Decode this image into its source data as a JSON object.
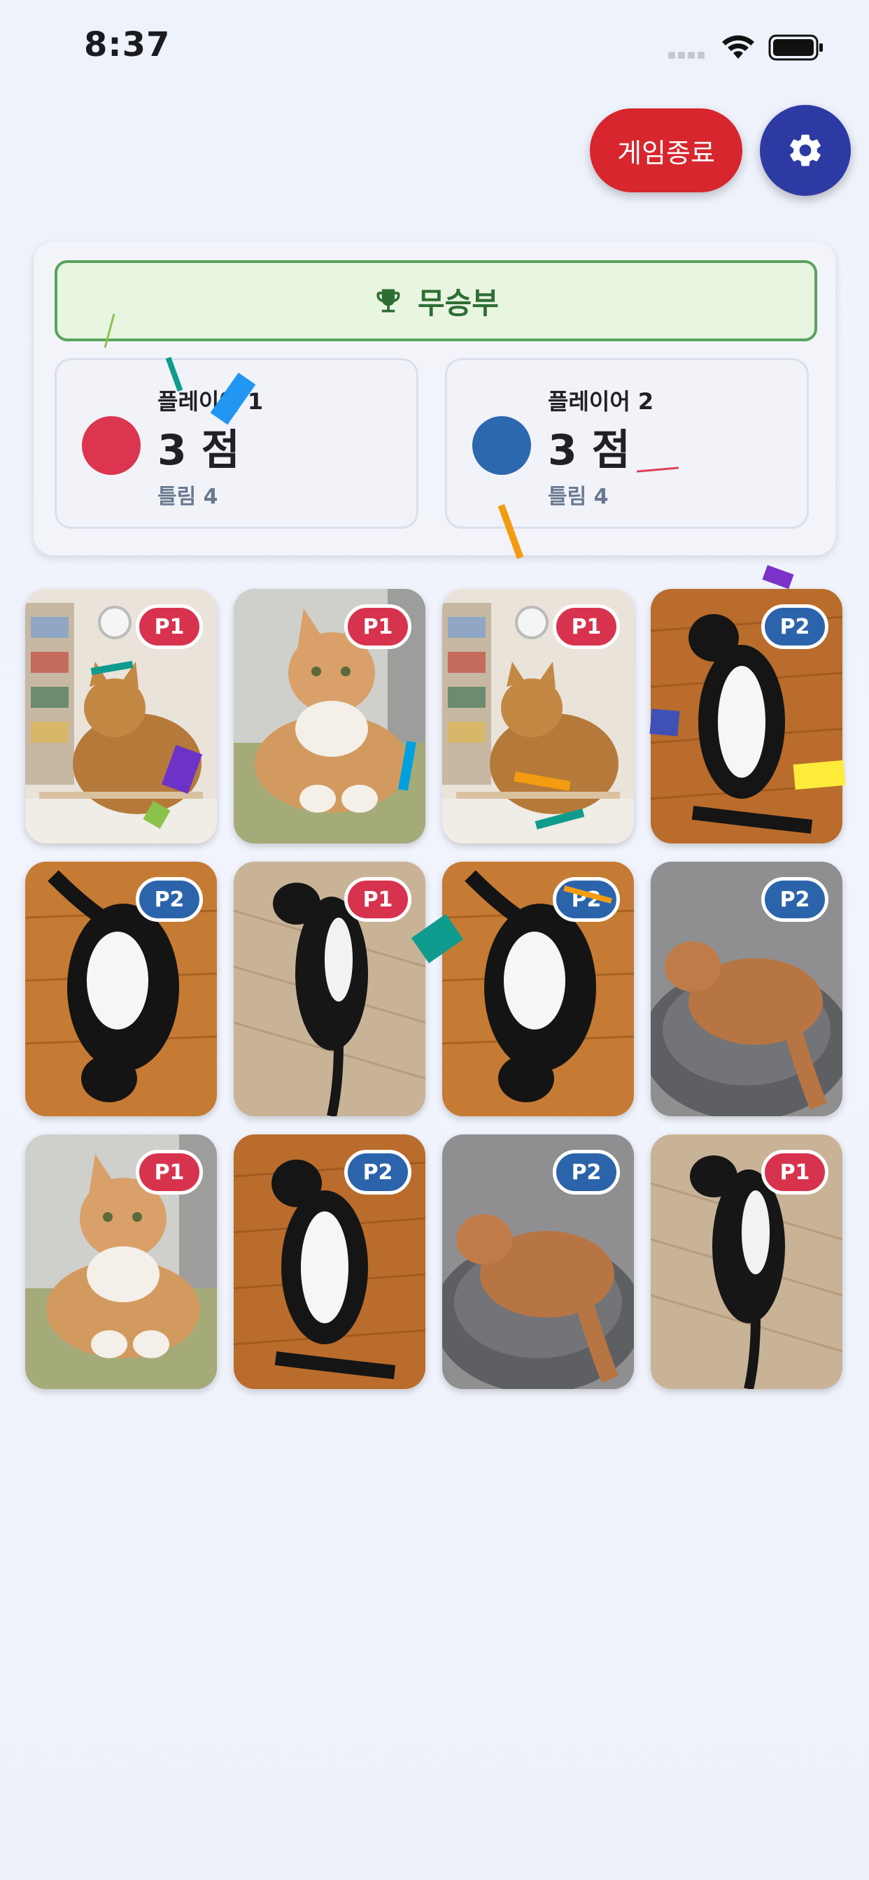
{
  "status_bar": {
    "time": "8:37"
  },
  "header": {
    "end_game_label": "게임종료",
    "settings_icon": "gear-icon"
  },
  "scoreboard": {
    "result_label": "무승부",
    "result_icon": "trophy-icon",
    "players": [
      {
        "name": "플레이어 1",
        "score": "3 점",
        "misses": "틀림 4",
        "color": "#dc3550"
      },
      {
        "name": "플레이어 2",
        "score": "3 점",
        "misses": "틀림 4",
        "color": "#2c68ad"
      }
    ]
  },
  "cards": [
    {
      "owner": "P1",
      "photo": "orange-cat-sitting-bookshelf"
    },
    {
      "owner": "P1",
      "photo": "orange-cat-lying-blanket"
    },
    {
      "owner": "P1",
      "photo": "orange-cat-sitting-bookshelf"
    },
    {
      "owner": "P2",
      "photo": "tuxedo-cat-on-back-wood-floor"
    },
    {
      "owner": "P2",
      "photo": "tuxedo-cat-upside-down-wood-floor"
    },
    {
      "owner": "P1",
      "photo": "tuxedo-cat-lying-laminate"
    },
    {
      "owner": "P2",
      "photo": "tuxedo-cat-upside-down-wood-floor"
    },
    {
      "owner": "P2",
      "photo": "orange-cat-grey-bed"
    },
    {
      "owner": "P1",
      "photo": "orange-cat-lying-blanket"
    },
    {
      "owner": "P2",
      "photo": "tuxedo-cat-on-back-wood-floor"
    },
    {
      "owner": "P2",
      "photo": "orange-cat-grey-bed"
    },
    {
      "owner": "P1",
      "photo": "tuxedo-cat-lying-laminate"
    }
  ],
  "colors": {
    "p1": "#d8334e",
    "p2": "#2c64ab",
    "end_button": "#d7262d",
    "settings_button": "#2e3aa3",
    "result_border": "#5aa35c"
  }
}
